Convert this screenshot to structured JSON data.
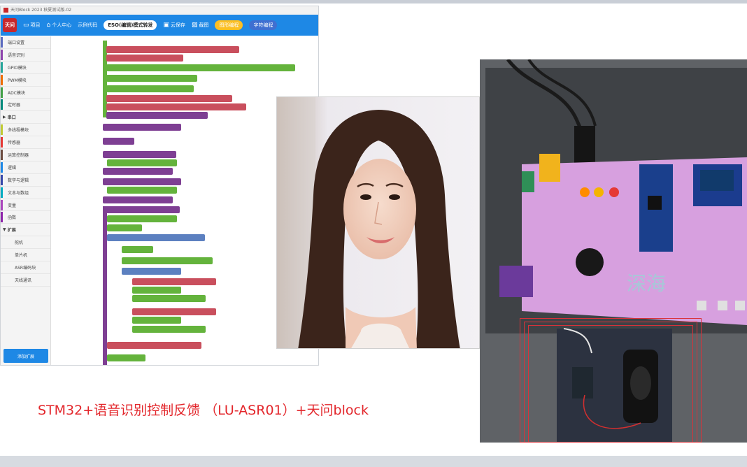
{
  "window": {
    "title": "天问Block 2023 秋夏测试版-02"
  },
  "toolbar": {
    "logo": "天问",
    "items": [
      "项目",
      "个人中心",
      "示例代码"
    ],
    "mode_switch": "ESO(编辑)模式转发",
    "save": "云保存",
    "screenshot": "截图",
    "buy": "图形编程",
    "char": "字符编程"
  },
  "sidebar": {
    "categories": [
      "端口设置",
      "语音识别",
      "GPIO模块",
      "PWM模块",
      "ADC模块",
      "定时器",
      "串口",
      "多线程模块",
      "传感器",
      "运算控制器",
      "逻辑",
      "数学与逻辑",
      "文本与数组",
      "变量",
      "函数",
      "扩展",
      "舵机",
      "单片机",
      "ASR编码块",
      "天线通讯"
    ],
    "add_extension": "添加扩展"
  },
  "caption": "STM32+语音识别控制反馈 （LU-ASR01）+天问block",
  "colors": {
    "brand_blue": "#1e88e5",
    "caption_red": "#e3272c",
    "block_purple": "#7e3f93",
    "block_green": "#64b33c",
    "board_pink": "#d7a0df"
  }
}
